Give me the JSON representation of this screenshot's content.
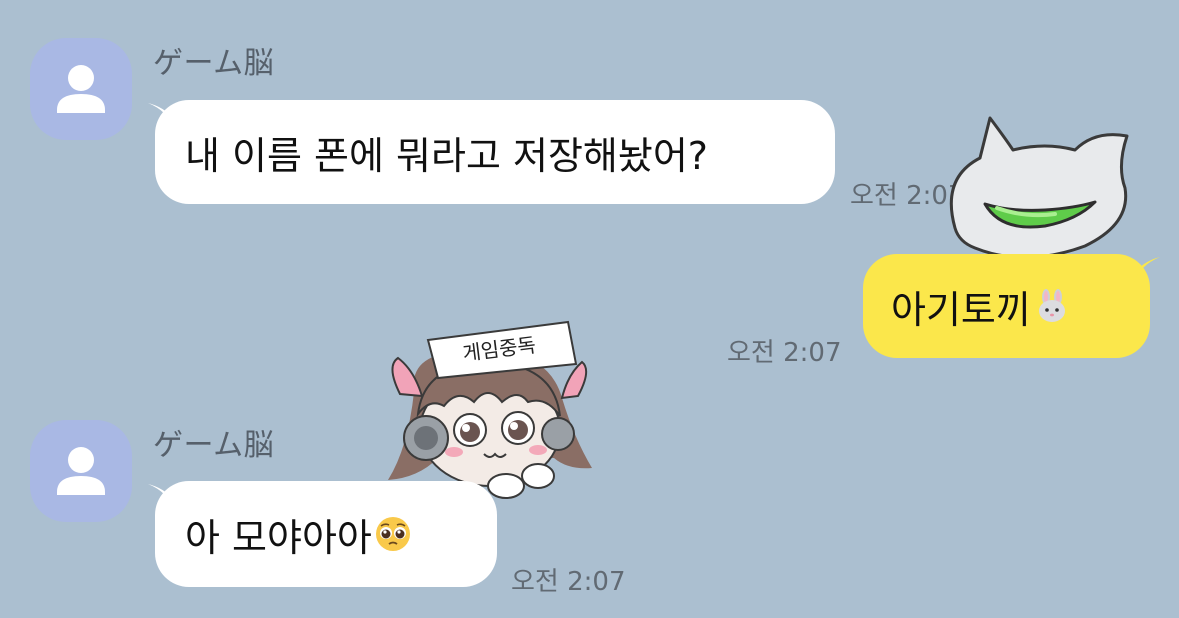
{
  "colors": {
    "background": "#abbfd0",
    "received_bubble": "#ffffff",
    "sent_bubble": "#fbe74b",
    "avatar": "#a9b8e4"
  },
  "messages": [
    {
      "direction": "received",
      "sender": "ゲーム脳",
      "avatar_icon": "person-icon",
      "text": "내 이름 폰에 뭐라고 저장해놨어?",
      "time": "오전 2:07"
    },
    {
      "direction": "sent",
      "text": "아기토끼",
      "emoji": "rabbit-face-emoji",
      "time": "오전 2:07",
      "sticker": "cat-ears-helmet-sticker"
    },
    {
      "direction": "received",
      "sticker": "game-addict-girl-sticker",
      "sticker_text": "게임중독"
    },
    {
      "direction": "received",
      "sender": "ゲーム脳",
      "avatar_icon": "person-icon",
      "text": "아 모야아아",
      "emoji": "pleading-face-emoji",
      "time": "오전 2:07"
    }
  ]
}
